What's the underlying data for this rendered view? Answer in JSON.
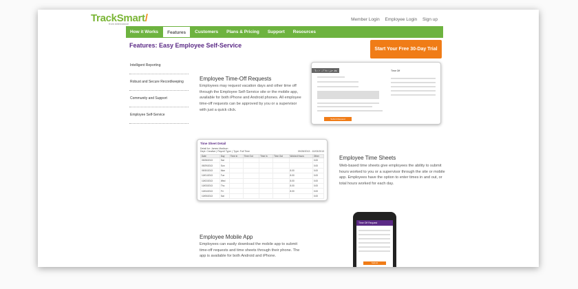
{
  "header": {
    "logo_main": "TrackSmart",
    "logo_mark": "/",
    "logo_sub": "from Attendance",
    "links": [
      "Member Login",
      "Employee Login",
      "Sign up"
    ]
  },
  "nav": {
    "items": [
      "How it Works",
      "Features",
      "Customers",
      "Plans & Pricing",
      "Support",
      "Resources"
    ],
    "active": "Features"
  },
  "page_title": "Features: Easy Employee Self-Service",
  "cta_label": "Start Your Free 30-Day Trial",
  "sidebar": {
    "items": [
      "Intelligent Reporting",
      "Robust and Secure Recordkeeping",
      "Community and Support",
      "Employee Self-Service"
    ]
  },
  "sections": {
    "timeoff": {
      "heading": "Employee Time-Off Requests",
      "body": "Employees may request vacation days and other time off through the Employee Self-Service site or the mobile app, available for both iPhone and Android phones. All employee time-off requests can be approved by you or a supervisor with just a quick click."
    },
    "timesheets": {
      "heading": "Employee Time Sheets",
      "body": "Web-based time sheets give employees the ability to submit hours worked to you or a supervisor through the site or mobile app. Employees have the option to enter times in and out, or total hours worked for each day."
    },
    "mobile": {
      "heading": "Employee Mobile App",
      "body": "Employees can easily download the mobile app to submit time-off requests and time sheets through their phone. The app is available for both Android and iPhone."
    }
  },
  "timeoff_screenshot": {
    "title": "Time-off Requests",
    "form_title": "Request Time Off",
    "side_title": "Time Off",
    "submit": "Submit Request"
  },
  "timesheet_screenshot": {
    "title": "Time Sheet Detail",
    "detail": "Detail for: James Madison",
    "meta": "Dept: Creative | Payroll Type: | Type: Full Time",
    "range": "09/28/2013 - 10/03/2013",
    "columns": [
      "Date",
      "Day",
      "Time In",
      "Time Out",
      "Time In",
      "Time Out",
      "Worked Hours",
      "Other"
    ],
    "rows": [
      [
        "09/28/2013",
        "Sat",
        "",
        "",
        "",
        "",
        "",
        "0.00"
      ],
      [
        "09/29/2013",
        "Sun",
        "",
        "",
        "",
        "",
        "",
        "0.00"
      ],
      [
        "09/30/2013",
        "Mon",
        "",
        "",
        "",
        "",
        "8.00",
        "0.00"
      ],
      [
        "10/01/2013",
        "Tue",
        "",
        "",
        "",
        "",
        "8.00",
        "0.00"
      ],
      [
        "10/02/2013",
        "Wed",
        "",
        "",
        "",
        "",
        "8.00",
        "0.00"
      ],
      [
        "10/03/2013",
        "Thu",
        "",
        "",
        "",
        "",
        "8.00",
        "0.00"
      ],
      [
        "10/04/2013",
        "Fri",
        "",
        "",
        "",
        "",
        "8.00",
        "0.00"
      ],
      [
        "10/05/2013",
        "Sat",
        "",
        "",
        "",
        "",
        "",
        "0.00"
      ]
    ]
  },
  "phone_screenshot": {
    "title": "Time Off Request",
    "submit": "Submit"
  },
  "colors": {
    "brand_green": "#6db33f",
    "brand_purple": "#5b2a86",
    "brand_orange": "#f07c17"
  }
}
